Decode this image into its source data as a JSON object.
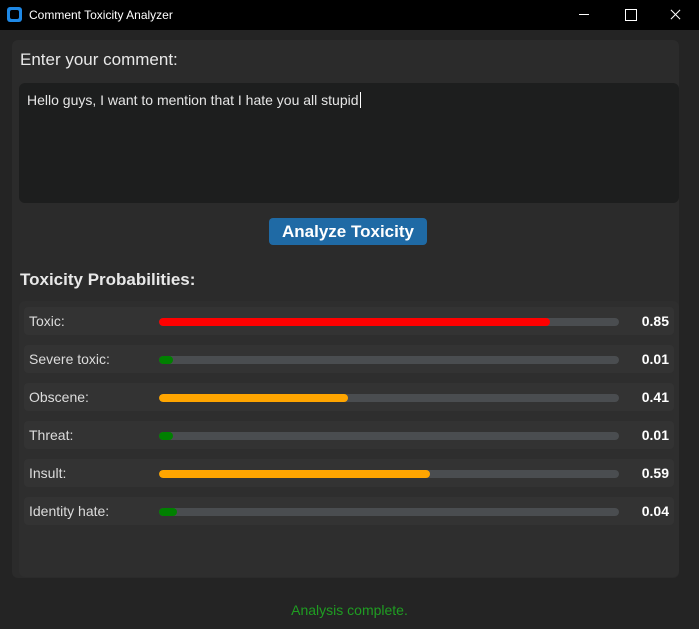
{
  "window": {
    "title": "Comment Toxicity Analyzer"
  },
  "input": {
    "label": "Enter your comment:",
    "value": "Hello guys, I want to mention that I hate you all stupid"
  },
  "analyze_button": {
    "label": "Analyze Toxicity",
    "color": "#1f6aa5"
  },
  "results": {
    "title": "Toxicity Probabilities:",
    "rows": [
      {
        "label": "Toxic:",
        "value": "0.85",
        "fraction": 0.85,
        "color": "#ff0000"
      },
      {
        "label": "Severe toxic:",
        "value": "0.01",
        "fraction": 0.01,
        "color": "#008000"
      },
      {
        "label": "Obscene:",
        "value": "0.41",
        "fraction": 0.41,
        "color": "#ffa500"
      },
      {
        "label": "Threat:",
        "value": "0.01",
        "fraction": 0.01,
        "color": "#008000"
      },
      {
        "label": "Insult:",
        "value": "0.59",
        "fraction": 0.59,
        "color": "#ffa500"
      },
      {
        "label": "Identity hate:",
        "value": "0.04",
        "fraction": 0.04,
        "color": "#008000"
      }
    ]
  },
  "status": {
    "text": "Analysis complete.",
    "color": "#1f9d22"
  }
}
